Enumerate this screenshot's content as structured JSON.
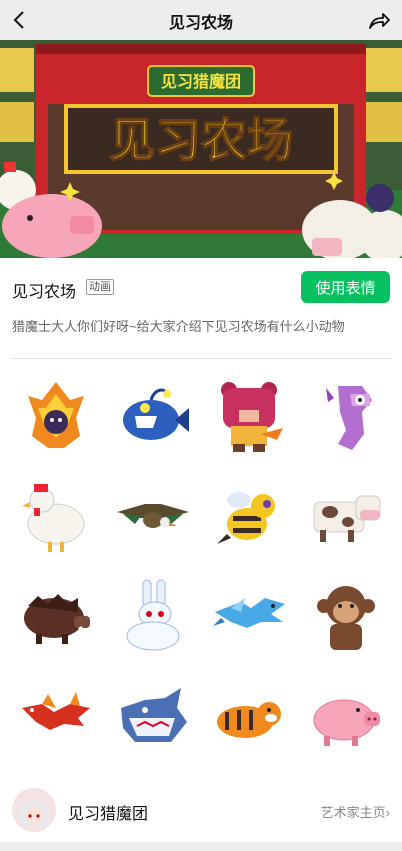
{
  "nav": {
    "title": "见习农场",
    "back_icon": "chevron-left-icon",
    "share_icon": "share-arrow-icon"
  },
  "banner": {
    "badge_text": "见习猎魔团",
    "headline": "见习农场"
  },
  "pack": {
    "title": "见习农场",
    "tag": "动画",
    "use_button_label": "使用表情",
    "description": "猎魔士大人你们好呀~给大家介绍下见习农场有什么小动物"
  },
  "stickers": [
    {
      "name": "fire-bat-sticker"
    },
    {
      "name": "blue-anglerfish-sticker"
    },
    {
      "name": "pink-bear-sticker"
    },
    {
      "name": "purple-seahorse-sticker"
    },
    {
      "name": "white-rooster-sticker"
    },
    {
      "name": "vulture-sticker"
    },
    {
      "name": "bee-sticker"
    },
    {
      "name": "cow-sticker"
    },
    {
      "name": "boar-sticker"
    },
    {
      "name": "white-rabbit-sticker"
    },
    {
      "name": "blue-dragon-sticker"
    },
    {
      "name": "monkey-sticker"
    },
    {
      "name": "red-dragon-sticker"
    },
    {
      "name": "shark-wolf-sticker"
    },
    {
      "name": "tiger-sticker"
    },
    {
      "name": "pig-sticker"
    }
  ],
  "artist": {
    "name": "见习猎魔团",
    "link_label": "艺术家主页",
    "link_icon": "chevron-right-icon"
  },
  "colors": {
    "accent_green": "#07c160",
    "nav_bg": "#ededed",
    "barn_red": "#c8262a",
    "sign_yellow": "#f4c531"
  }
}
